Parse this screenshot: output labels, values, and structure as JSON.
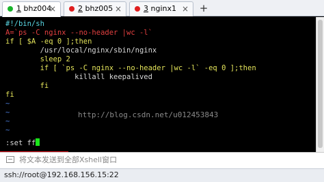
{
  "tabs": [
    {
      "number": "1",
      "name": "bhz004",
      "status_color": "#18b52b",
      "active": true
    },
    {
      "number": "2",
      "name": "bhz005",
      "status_color": "#e01f1f",
      "active": false
    },
    {
      "number": "3",
      "name": "nginx1",
      "status_color": "#e01f1f",
      "active": false
    }
  ],
  "tab_close_glyph": "×",
  "add_tab_glyph": "+",
  "terminal": {
    "lines": [
      "#!/bin/sh",
      "A=`ps -C nginx --no-header |wc -l`",
      "if [ $A -eq 0 ];then",
      "        /usr/local/nginx/sbin/nginx",
      "        sleep 2",
      "        if [ `ps -C nginx --no-header |wc -l` -eq 0 ];then",
      "                killall keepalived",
      "        fi",
      "fi",
      "~",
      "~",
      "~",
      "~"
    ],
    "command": ":set ff",
    "watermark": "http://blog.csdn.net/u012453843"
  },
  "compose": {
    "placeholder": "将文本发送到全部Xshell窗口"
  },
  "status": {
    "connection": "ssh://root@192.168.156.15:22"
  },
  "colors": {
    "cursor": "#19e619",
    "highlight_box": "#e0141b"
  }
}
